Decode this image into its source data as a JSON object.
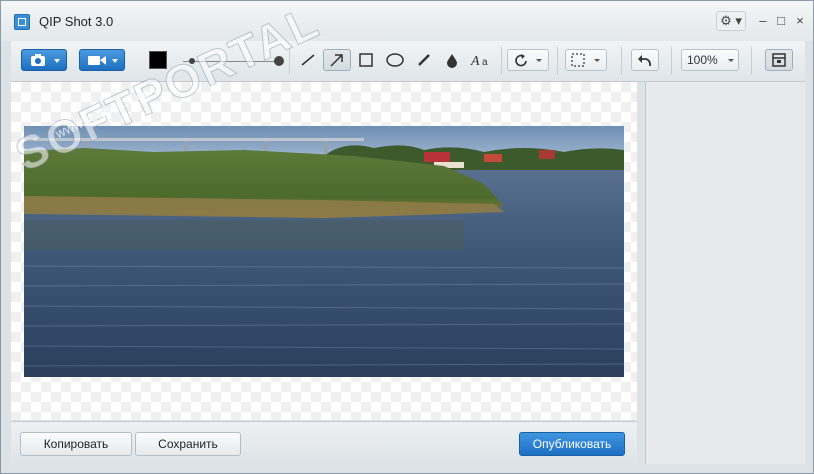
{
  "window": {
    "title": "QIP Shot 3.0"
  },
  "titlebar": {
    "gear": "⚙ ▾",
    "minimize": "–",
    "maximize": "□",
    "close": "×"
  },
  "toolbar": {
    "zoom": "100%"
  },
  "watermark": {
    "brand": "SOFTPORTAL",
    "tm": "™",
    "url": "www.softportal.com"
  },
  "bottom": {
    "copy_label": "Копировать",
    "save_label": "Сохранить",
    "publish_label": "Опубликовать"
  },
  "colors": {
    "accent": "#1e6fc0",
    "canvas_bg": "#ffffff",
    "panel_bg": "#e6eaed"
  }
}
